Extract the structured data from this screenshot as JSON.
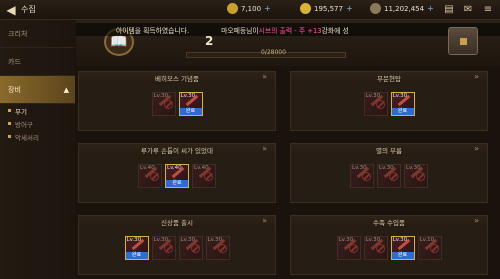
{
  "header": {
    "back_label": "◀",
    "title": "수집",
    "resources": [
      {
        "value": "7,100",
        "color": "#c8a030"
      },
      {
        "value": "195,577",
        "color": "#d9b23a"
      },
      {
        "value": "11,202,454",
        "color": "#8a7a5a"
      }
    ],
    "plus": "+"
  },
  "sidebar": {
    "items": [
      {
        "label": "크리처"
      },
      {
        "label": "카드"
      },
      {
        "label": "장비"
      }
    ],
    "expand_icon": "▲",
    "subitems": [
      {
        "label": "무기"
      },
      {
        "label": "방어구"
      },
      {
        "label": "악세서리"
      }
    ]
  },
  "banner": {
    "toast_left": "아이템을 획득하였습니다.",
    "toast_right_prefix": "마오페등님이 ",
    "toast_right_highlight": "시브의 출력 - 주 +13",
    "toast_right_suffix": " 강화에 성",
    "level": "2",
    "progress_label": "0/28000",
    "progress": 0
  },
  "panels": [
    {
      "title": "베히모스 기념품",
      "slots": [
        {
          "lv": "Lv.30",
          "done": false
        },
        {
          "lv": "Lv.30",
          "done": true
        }
      ]
    },
    {
      "title": "무문현탑",
      "slots": [
        {
          "lv": "Lv.30",
          "done": false
        },
        {
          "lv": "Lv.30",
          "done": true
        }
      ]
    },
    {
      "title": "루가루 손톱이 씨가 있었대",
      "slots": [
        {
          "lv": "Lv.40",
          "done": false
        },
        {
          "lv": "Lv.40",
          "done": true
        },
        {
          "lv": "Lv.40",
          "done": false
        }
      ]
    },
    {
      "title": "별의 부름",
      "slots": [
        {
          "lv": "Lv.30",
          "done": false
        },
        {
          "lv": "Lv.30",
          "done": false
        },
        {
          "lv": "Lv.30",
          "done": false
        }
      ]
    },
    {
      "title": "신상품 출시",
      "slots": [
        {
          "lv": "Lv.30",
          "done": true
        },
        {
          "lv": "Lv.30",
          "done": false
        },
        {
          "lv": "Lv.30",
          "done": false
        },
        {
          "lv": "Lv.30",
          "done": false
        }
      ]
    },
    {
      "title": "수족 수입품",
      "slots": [
        {
          "lv": "Lv.30",
          "done": false
        },
        {
          "lv": "Lv.30",
          "done": false
        },
        {
          "lv": "Lv.30",
          "done": true
        },
        {
          "lv": "Lv.10",
          "done": false
        }
      ]
    }
  ],
  "done_label": "완료",
  "chevron": "»"
}
